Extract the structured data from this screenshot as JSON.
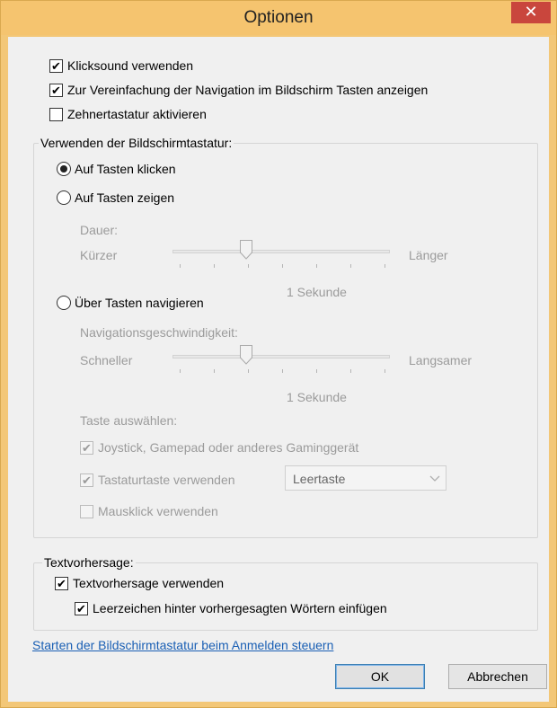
{
  "dialog": {
    "title": "Optionen",
    "close_glyph": "✕"
  },
  "top_options": [
    {
      "label": "Klicksound verwenden",
      "checked": true
    },
    {
      "label": "Zur Vereinfachung der Navigation im Bildschirm Tasten anzeigen",
      "checked": true
    },
    {
      "label": "Zehnertastatur aktivieren",
      "checked": false
    }
  ],
  "keyboard_group": {
    "legend": "Verwenden der Bildschirmtastatur:",
    "mode_click": "Auf Tasten klicken",
    "mode_hover": "Auf Tasten zeigen",
    "selected_mode": "click",
    "duration_label": "Dauer:",
    "shorter": "Kürzer",
    "longer": "Länger",
    "duration_value": "1 Sekunde",
    "mode_scan": "Über Tasten navigieren",
    "speed_label": "Navigationsgeschwindigkeit:",
    "faster": "Schneller",
    "slower": "Langsamer",
    "speed_value": "1 Sekunde",
    "key_select_label": "Taste auswählen:",
    "joystick": "Joystick, Gamepad oder anderes Gaminggerät",
    "keyboard_key": "Tastaturtaste verwenden",
    "keyboard_key_value": "Leertaste",
    "mouse_click": "Mausklick verwenden"
  },
  "prediction_group": {
    "legend": "Textvorhersage:",
    "use_prediction": "Textvorhersage verwenden",
    "insert_space": "Leerzeichen hinter vorhergesagten Wörtern einfügen"
  },
  "startup_link": "Starten der Bildschirmtastatur beim Anmelden steuern",
  "buttons": {
    "ok": "OK",
    "cancel": "Abbrechen"
  },
  "check_glyph": "✔",
  "colors": {
    "titlebar": "#f5c46f",
    "close": "#c9463d",
    "link": "#1a5fb4",
    "disabled_text": "#9b9b9b"
  }
}
